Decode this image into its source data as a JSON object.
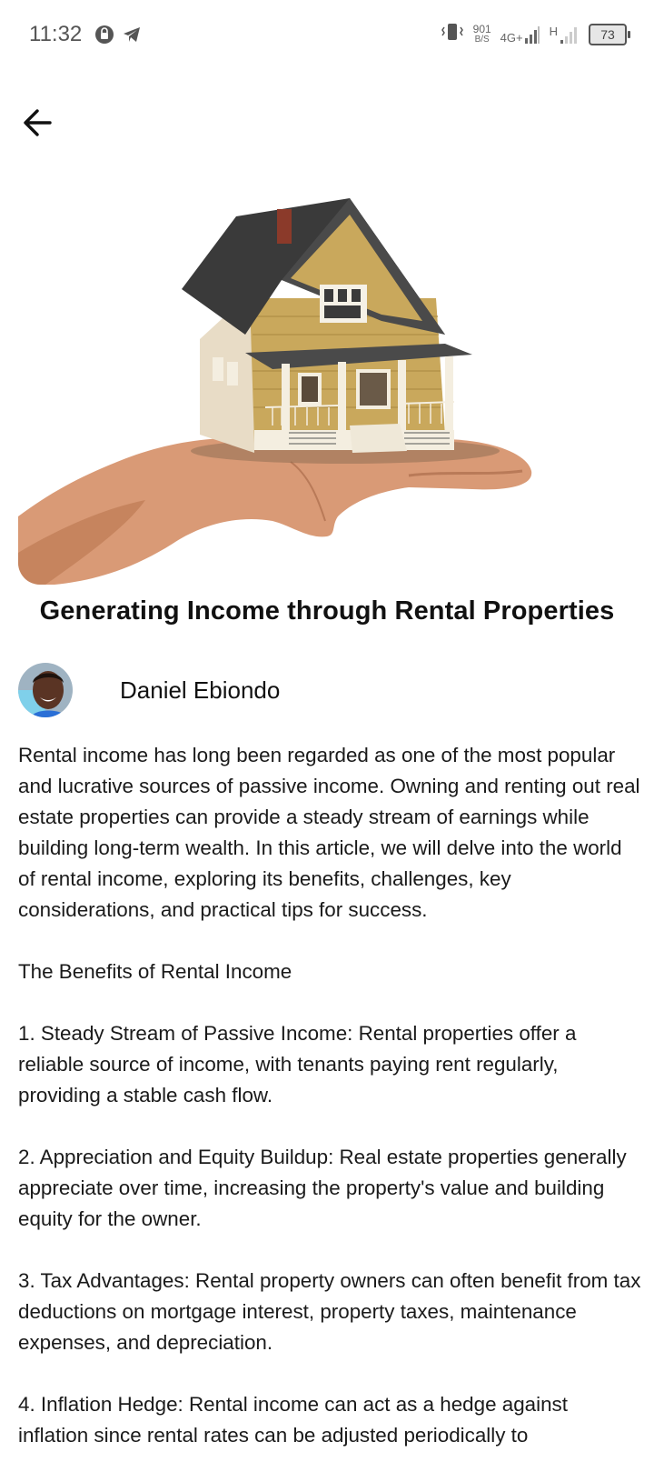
{
  "status_bar": {
    "time": "11:32",
    "net_speed_value": "901",
    "net_speed_unit": "B/S",
    "network_type": "4G+",
    "secondary_network": "H",
    "battery_level": "73",
    "icons": [
      "notification-app-icon",
      "telegram-icon",
      "vibrate-icon",
      "signal-icon",
      "battery-icon"
    ]
  },
  "header": {
    "back_icon": "arrow-left-icon"
  },
  "article": {
    "title": "Generating Income through Rental Properties",
    "author": "Daniel Ebiondo",
    "paragraphs": [
      "Rental income has long been regarded as one of the most popular and lucrative sources of passive income. Owning and renting out real estate properties can provide a steady stream of earnings while building long-term wealth. In this article, we will delve into the world of rental income, exploring its benefits, challenges, key considerations, and practical tips for success.",
      "The Benefits of Rental Income",
      "1. Steady Stream of Passive Income: Rental properties offer a reliable source of income, with tenants paying rent regularly, providing a stable cash flow.",
      "2. Appreciation and Equity Buildup: Real estate properties generally appreciate over time, increasing the property's value and building equity for the owner.",
      "3. Tax Advantages: Rental property owners can often benefit from tax deductions on mortgage interest, property taxes, maintenance expenses, and depreciation.",
      "4. Inflation Hedge: Rental income can act as a hedge against inflation since rental rates can be adjusted periodically to"
    ]
  },
  "colors": {
    "background": "#ffffff",
    "text": "#111111",
    "house_siding": "#c9a85c",
    "roof": "#3a3a3a",
    "skin": "#d99a76"
  }
}
